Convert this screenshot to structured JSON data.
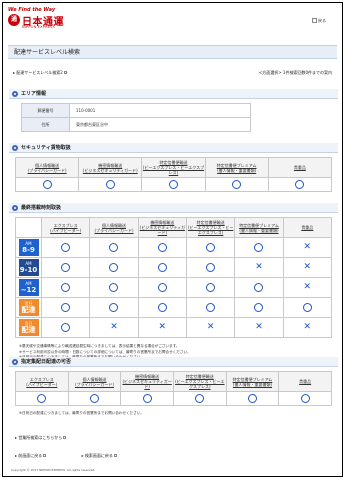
{
  "header": {
    "tagline": "We Find the Way",
    "logo_mark": "通",
    "logo_jp": "日本通運",
    "logo_en": "NIPPON EXPRESS",
    "back_link": "戻る"
  },
  "page_title": "配達サービスレベル検索",
  "breadcrumb": "配達サービスレベル検索2",
  "breadcrumb_note": "<方面選択> 1件検索回数0件までの案内",
  "area": {
    "title": "エリア情報",
    "rows": [
      {
        "key": "郵便番号",
        "value": "110-0001"
      },
      {
        "key": "住所",
        "value": "東京都台東区谷中"
      }
    ]
  },
  "security": {
    "title": "セキュリティ貨物取扱",
    "columns": [
      {
        "name": "個人情報輸送",
        "sub": "(プライバシーガード)"
      },
      {
        "name": "機密情報輸送",
        "sub": "(ビジネスセキュリティガード)"
      },
      {
        "name": "特定信書便輸送",
        "sub": "(ビーエクスプレス・ビーエクスプレス)"
      },
      {
        "name": "特定信書便プレミアム",
        "sub": "(書人情報・重要書類)"
      },
      {
        "name": "貴重品",
        "sub": ""
      }
    ],
    "marks": [
      "circle",
      "circle",
      "circle",
      "circle",
      "circle"
    ]
  },
  "delivery": {
    "title": "最終搭載時刻取扱",
    "columns": [
      {
        "name": "エクスプレス",
        "sub": "(ハイプビーダー)"
      },
      {
        "name": "個人情報輸送",
        "sub": "(プライバシーガード)"
      },
      {
        "name": "機密情報輸送",
        "sub": "(ビジネスセキュリティガード)"
      },
      {
        "name": "特定信書便輸送",
        "sub": "(ビーエクスプレス・ビーエクスプレス)"
      },
      {
        "name": "特定信書便プレミアム",
        "sub": "(書人情報・重要書類)"
      },
      {
        "name": "貴重品",
        "sub": ""
      }
    ],
    "rows": [
      {
        "label_top": "AM",
        "label_main": "8-9",
        "badge": "blue",
        "marks": [
          "circle",
          "circle",
          "circle",
          "circle",
          "circle",
          "cross"
        ]
      },
      {
        "label_top": "AM",
        "label_main": "9-10",
        "badge": "dark",
        "marks": [
          "circle",
          "circle",
          "circle",
          "circle",
          "cross",
          "cross"
        ]
      },
      {
        "label_top": "AM",
        "label_main": "~12",
        "badge": "blue",
        "marks": [
          "circle",
          "circle",
          "circle",
          "circle",
          "circle",
          "cross"
        ]
      },
      {
        "label_top": "翌日",
        "label_main": "配達",
        "badge": "orange",
        "marks": [
          "circle",
          "circle",
          "circle",
          "circle",
          "circle",
          "circle"
        ]
      },
      {
        "label_top": "当日",
        "label_main": "配達",
        "badge": "orange",
        "marks": [
          "circle",
          "cross",
          "cross",
          "cross",
          "cross",
          "cross"
        ]
      }
    ],
    "notes": [
      "※悪天候や交通事情等により輸送遅延発生時につきましては、表示結果と異なる場合がございます。",
      "※サービス利用可否以外の時間・日数についての詳細については、最寄りの営業所までお問合せください。",
      "※日祝日の配達につきましては、最寄りの営業所までお問い合わせください。"
    ]
  },
  "holiday": {
    "title": "指定集配日配達の可否",
    "columns": [
      {
        "name": "エクスプレス",
        "sub": "(ハイプビーダー)"
      },
      {
        "name": "個人情報輸送",
        "sub": "(プライバシーガード)"
      },
      {
        "name": "機密情報輸送",
        "sub": "(ビジネスセキュリティガード)"
      },
      {
        "name": "特定信書便輸送",
        "sub": "(ビーエクスプレス・ビーエクスプレス)"
      },
      {
        "name": "特定信書便プレミアム",
        "sub": "(書人情報・重要書類)"
      },
      {
        "name": "貴重品",
        "sub": ""
      }
    ],
    "marks": [
      "circle",
      "circle",
      "circle",
      "circle",
      "circle",
      "circle"
    ],
    "note": "※日祝日の配達につきましては、最寄りの営業所までお問い合わせください。"
  },
  "office_link": "営業所検索はこちらから",
  "prev_link": "前画面に戻る",
  "top_link": "検索画面に戻る",
  "copyright": "Copyright © 2017 NIPPON EXPRESS. All rights reserved."
}
